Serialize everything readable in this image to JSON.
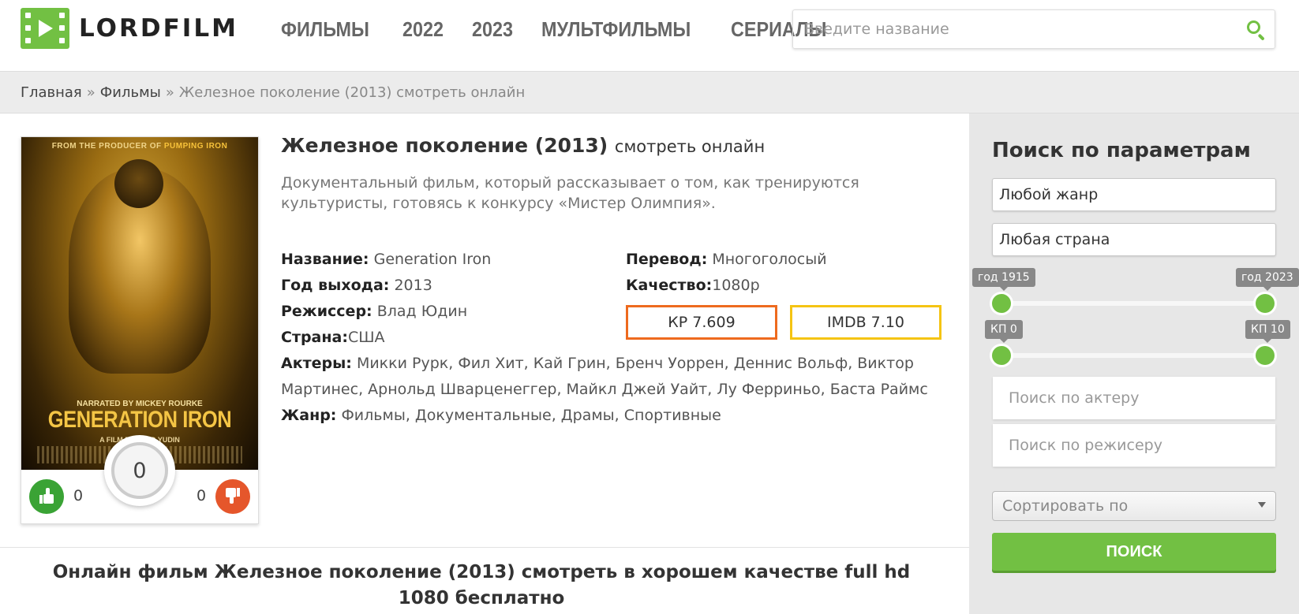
{
  "header": {
    "logo_text": "LORDFILM",
    "nav": [
      "ФИЛЬМЫ",
      "2022",
      "2023",
      "МУЛЬТФИЛЬМЫ",
      "СЕРИАЛЫ"
    ],
    "search_placeholder": "Введите название"
  },
  "breadcrumb": {
    "home": "Главная",
    "sep": "»",
    "section": "Фильмы",
    "current": "Железное поколение (2013) смотреть онлайн"
  },
  "poster": {
    "top_line_a": "FROM THE PRODUCER OF",
    "top_line_b": "PUMPING IRON",
    "narrated": "NARRATED BY MICKEY ROURKE",
    "title": "GENERATION IRON",
    "film_by": "A FILM BY VLAD YUDIN"
  },
  "votes": {
    "rating": "0",
    "likes": "0",
    "dislikes": "0"
  },
  "film": {
    "title": "Железное поколение (2013)",
    "title_suffix": "смотреть онлайн",
    "description": "Документальный фильм, который рассказывает о том, как тренируются культуристы, готовясь к конкурсу «Мистер Олимпия».",
    "name_label": "Название:",
    "name_value": "Generation Iron",
    "year_label": "Год выхода:",
    "year_value": "2013",
    "director_label": "Режиссер:",
    "director_value": "Влад Юдин",
    "country_label": "Страна:",
    "country_value": "США",
    "actors_label": "Актеры:",
    "actors_value": "Микки Рурк, Фил Хит, Кай Грин, Бренч Уоррен, Деннис Вольф, Виктор Мартинес, Арнольд Шварценеггер, Майкл Джей Уайт, Лу Ферриньо, Баста Раймс",
    "genre_label": "Жанр:",
    "genre_value": "Фильмы, Документальные, Драмы, Спортивные",
    "translation_label": "Перевод:",
    "translation_value": "Многоголосый",
    "quality_label": "Качество:",
    "quality_value": "1080p",
    "kp": "КР 7.609",
    "imdb": "IMDB 7.10"
  },
  "bottom": {
    "title": "Онлайн фильм Железное поколение (2013) смотреть в хорошем качестве full hd 1080 бесплатно"
  },
  "sidebar": {
    "title": "Поиск по параметрам",
    "genre_select": "Любой жанр",
    "country_select": "Любая страна",
    "year_min": "год 1915",
    "year_max": "год 2023",
    "kp_min": "КП 0",
    "kp_max": "КП 10",
    "actor_placeholder": "Поиск по актеру",
    "director_placeholder": "Поиск по режисеру",
    "sort_select": "Сортировать по",
    "search_button": "ПОИСК"
  },
  "colors": {
    "accent": "#72c043",
    "kp_border": "#ee6a1e",
    "imdb_border": "#f5c413",
    "like": "#3aa335",
    "dislike": "#e5562b"
  }
}
